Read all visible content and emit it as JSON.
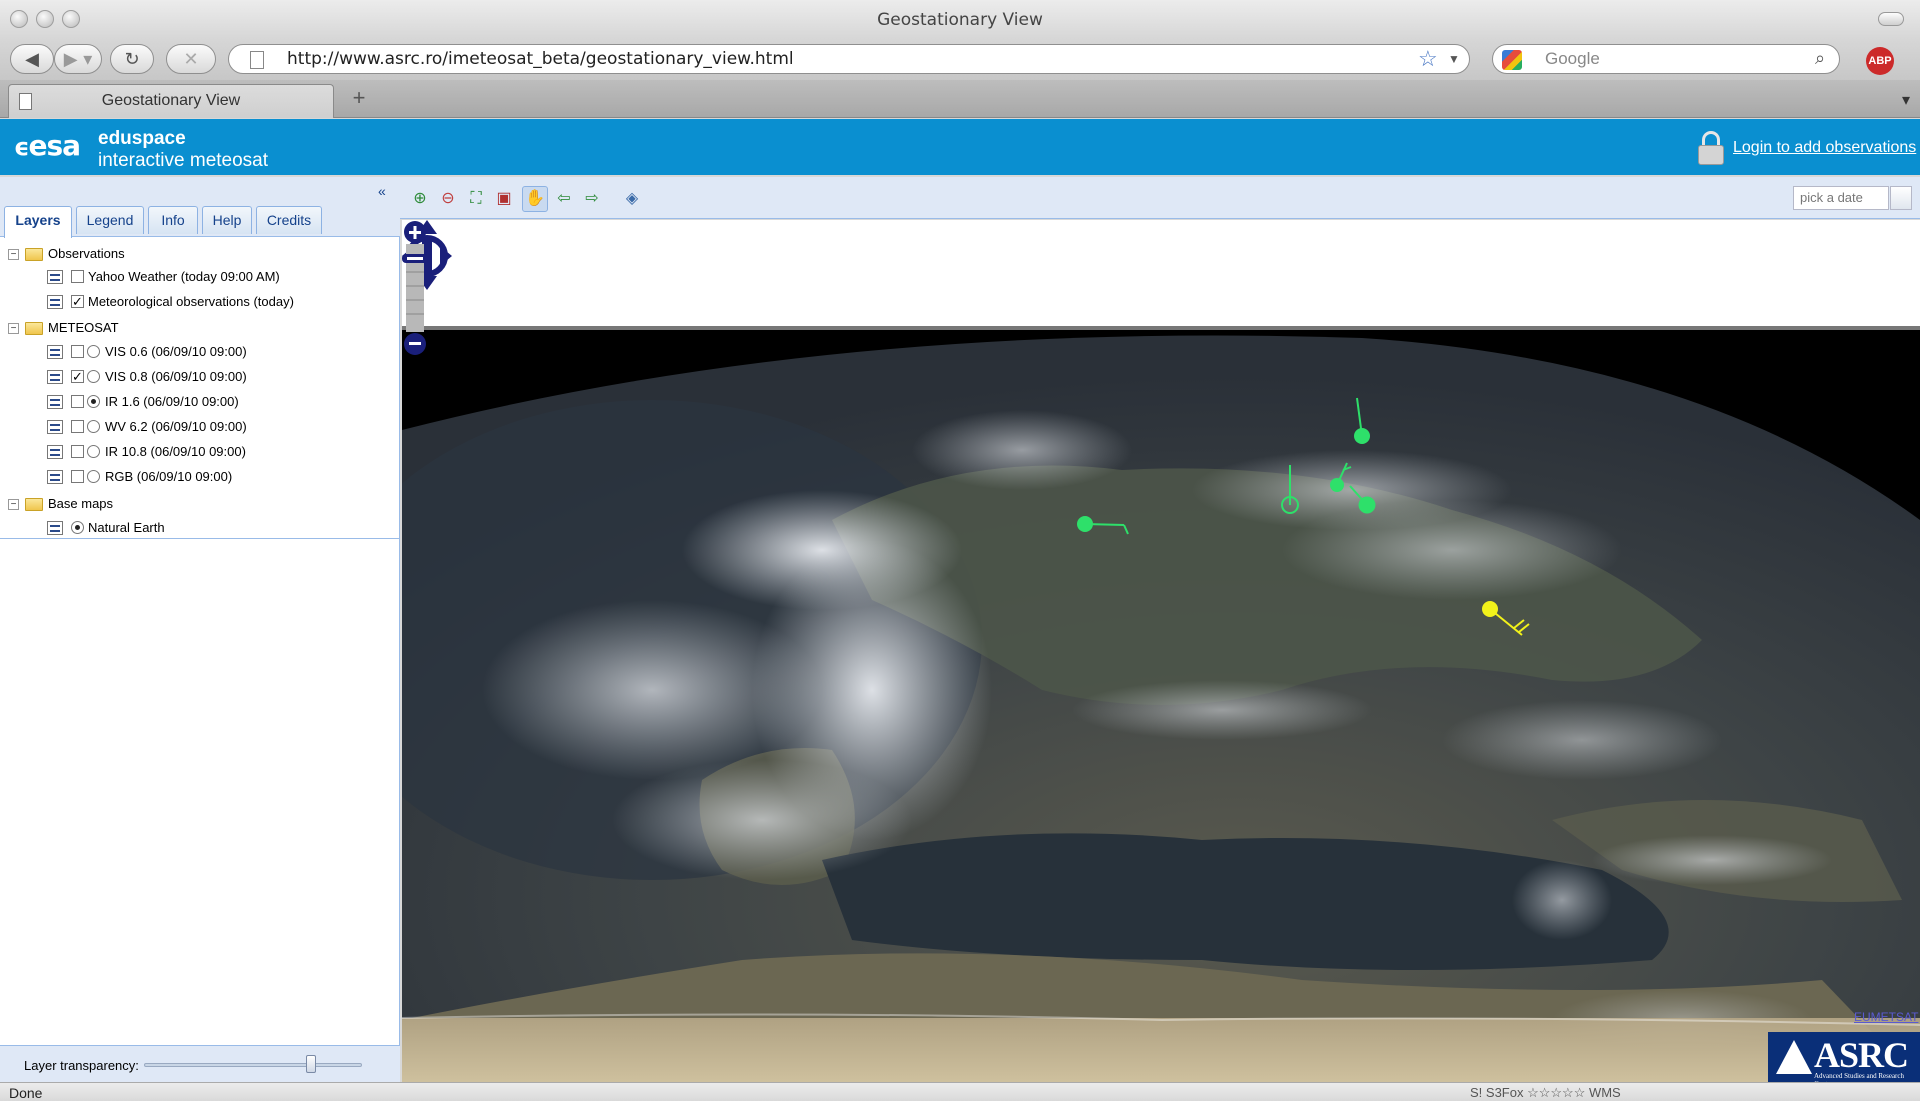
{
  "window": {
    "title": "Geostationary View"
  },
  "toolbar": {
    "url": "http://www.asrc.ro/imeteosat_beta/geostationary_view.html",
    "search_placeholder": "Google",
    "abp_label": "ABP"
  },
  "tabs": [
    {
      "label": "Geostationary View"
    }
  ],
  "header": {
    "brand_logo": "esa",
    "brand_line1": "eduspace",
    "brand_line2": "interactive meteosat",
    "login_link": "Login to add observations"
  },
  "panel": {
    "tabs": [
      "Layers",
      "Legend",
      "Info",
      "Help",
      "Credits"
    ],
    "active_tab": "Layers",
    "tree": [
      {
        "type": "folder",
        "label": "Observations"
      },
      {
        "type": "layer",
        "label": "Yahoo Weather (today 09:00 AM)",
        "checked": false
      },
      {
        "type": "layer",
        "label": "Meteorological observations (today)",
        "checked": true
      },
      {
        "type": "folder",
        "label": "METEOSAT"
      },
      {
        "type": "layer",
        "label": "VIS 0.6 (06/09/10 09:00)",
        "checked": false,
        "selected": false
      },
      {
        "type": "layer",
        "label": "VIS 0.8 (06/09/10 09:00)",
        "checked": true,
        "selected": false
      },
      {
        "type": "layer",
        "label": "IR 1.6 (06/09/10 09:00)",
        "checked": false,
        "selected": true
      },
      {
        "type": "layer",
        "label": "WV 6.2 (06/09/10 09:00)",
        "checked": false,
        "selected": false
      },
      {
        "type": "layer",
        "label": "IR 10.8 (06/09/10 09:00)",
        "checked": false,
        "selected": false
      },
      {
        "type": "layer",
        "label": "RGB (06/09/10 09:00)",
        "checked": false,
        "selected": false
      },
      {
        "type": "folder",
        "label": "Base maps"
      },
      {
        "type": "layer",
        "label": "Natural Earth",
        "selected": true
      }
    ],
    "transparency_label": "Layer transparency:",
    "transparency_value": 0.78
  },
  "map": {
    "date_placeholder": "pick a date",
    "attribution": "EUMETSAT",
    "logo_text": "ASRC",
    "logo_subtext": "Advanced Studies and Research Center",
    "colors": {
      "space": "#000000",
      "ocean": "#2d3740",
      "land": "#4a5148",
      "cloud": "#d9dde2",
      "obs_green": "#2ee06a",
      "obs_yellow": "#f2f21a",
      "nav": "#1a1f7a"
    }
  },
  "status": {
    "text": "Done",
    "addons_text": "S! S3Fox ☆☆☆☆☆ WMS"
  }
}
